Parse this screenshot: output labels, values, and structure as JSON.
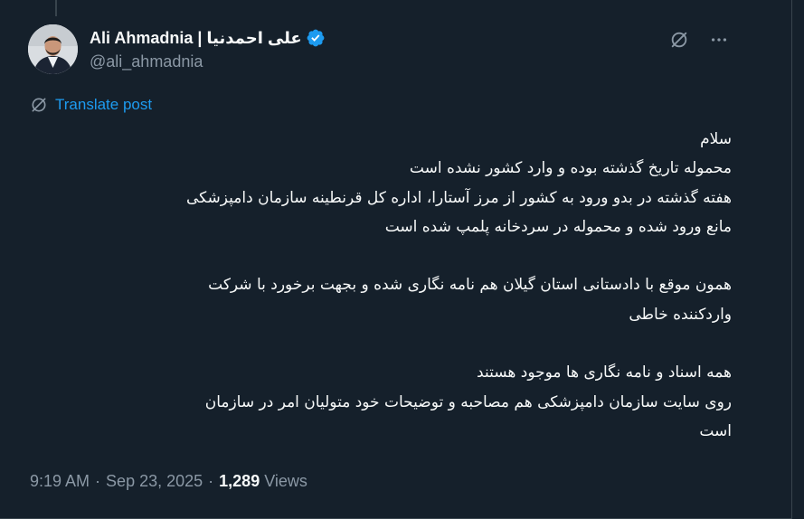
{
  "author": {
    "display_name": "Ali Ahmadnia | علی احمدنیا",
    "handle": "@ali_ahmadnia",
    "avatar_icon": "avatar-photo",
    "verified_icon": "verified-badge-icon"
  },
  "actions": {
    "grok_icon": "grok-icon",
    "more_icon": "more-icon"
  },
  "translate": {
    "label": "Translate post",
    "icon": "translate-icon"
  },
  "post": {
    "lines": [
      "سلام",
      "محموله تاریخ گذشته بوده و وارد کشور نشده است",
      "هفته گذشته در بدو ورود به کشور از مرز آستارا، اداره کل قرنطینه سازمان دامپزشکی",
      "مانع ورود شده و محموله در سردخانه پلمپ شده است",
      "",
      "همون موقع با دادستانی استان گیلان هم نامه نگاری شده و بجهت برخورد با شرکت",
      "واردکننده خاطی",
      "",
      "همه اسناد و نامه نگاری ها موجود هستند",
      "روی سایت سازمان دامپزشکی هم مصاحبه و توضیحات خود متولیان امر در سازمان",
      "است"
    ]
  },
  "meta": {
    "time": "9:19 AM",
    "date": "Sep 23, 2025",
    "views_count": "1,289",
    "views_label": "Views",
    "separator": "·"
  },
  "colors": {
    "background": "#15202b",
    "text": "#f7f9f9",
    "muted": "#8b98a5",
    "accent": "#1d9bf0",
    "border": "#38444d"
  }
}
